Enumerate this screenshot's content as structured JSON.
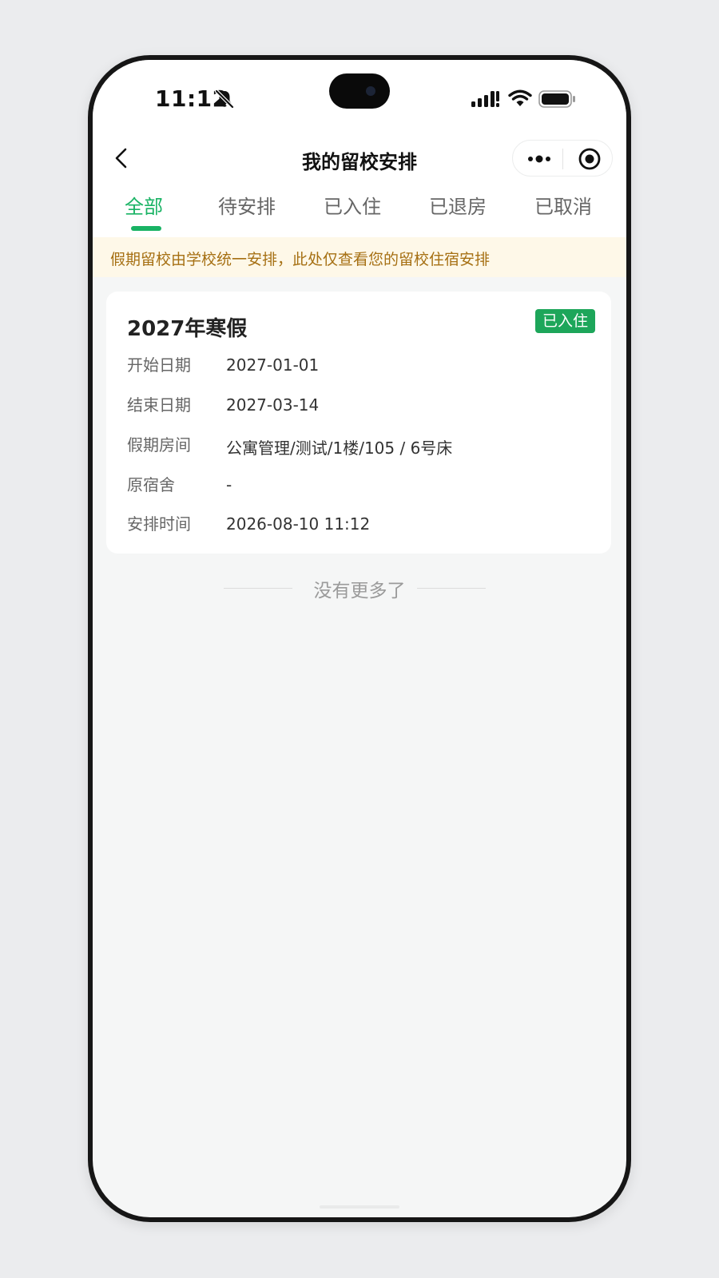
{
  "status_bar": {
    "time": "11:12",
    "icons": [
      "bell-off-icon",
      "cellular-signal-icon",
      "wifi-icon",
      "battery-icon"
    ]
  },
  "nav": {
    "title": "我的留校安排",
    "back_icon": "back-chevron-icon",
    "more_icon": "more-dots-icon",
    "close_icon": "target-close-icon"
  },
  "tabs": [
    {
      "label": "全部",
      "active": true
    },
    {
      "label": "待安排",
      "active": false
    },
    {
      "label": "已入住",
      "active": false
    },
    {
      "label": "已退房",
      "active": false
    },
    {
      "label": "已取消",
      "active": false
    }
  ],
  "notice": {
    "text": "假期留校由学校统一安排，此处仅查看您的留校住宿安排"
  },
  "records": [
    {
      "title": "2027年寒假",
      "status": "已入住",
      "fields": [
        {
          "label": "开始日期",
          "value": "2027-01-01"
        },
        {
          "label": "结束日期",
          "value": "2027-03-14"
        },
        {
          "label": "假期房间",
          "value": "公寓管理/测试/1楼/105 / 6号床"
        },
        {
          "label": "原宿舍",
          "value": "-"
        },
        {
          "label": "安排时间",
          "value": "2026-08-10 11:12"
        }
      ]
    }
  ],
  "list_end_text": "没有更多了",
  "colors": {
    "accent": "#19b364",
    "badge": "#1da65a",
    "notice_bg": "#fef8e8",
    "notice_text": "#a67013",
    "page_bg": "#f5f6f6"
  }
}
